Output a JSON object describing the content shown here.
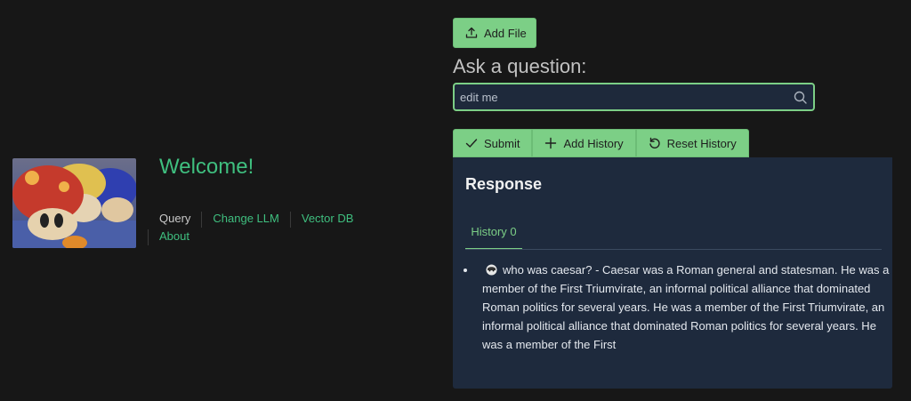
{
  "sidebar": {
    "welcome": "Welcome!",
    "nav": {
      "query": "Query",
      "change_llm": "Change LLM",
      "vector_db": "Vector DB",
      "about": "About"
    }
  },
  "main": {
    "add_file_label": "Add File",
    "question_label": "Ask a question:",
    "question_input": {
      "value": "edit me",
      "placeholder": ""
    },
    "buttons": {
      "submit": "Submit",
      "add_history": "Add History",
      "reset_history": "Reset History"
    },
    "response": {
      "title": "Response",
      "tabs": [
        "History 0"
      ],
      "items": [
        {
          "question": "who was caesar?",
          "answer": "- Caesar was a Roman general and statesman. He was a member of the First Triumvirate, an informal political alliance that dominated Roman politics for several years. He was a member of the First Triumvirate, an informal political alliance that dominated Roman politics for several years. He was a member of the First"
        }
      ]
    }
  },
  "colors": {
    "background": "#171717",
    "accent": "#3fbf7f",
    "button": "#7ccf86",
    "panel": "#1e2a3d"
  },
  "icons": {
    "upload": "upload-icon",
    "search": "search-icon",
    "check": "check-icon",
    "plus": "plus-icon",
    "reset": "refresh-icon",
    "user": "user-emoji-icon"
  }
}
